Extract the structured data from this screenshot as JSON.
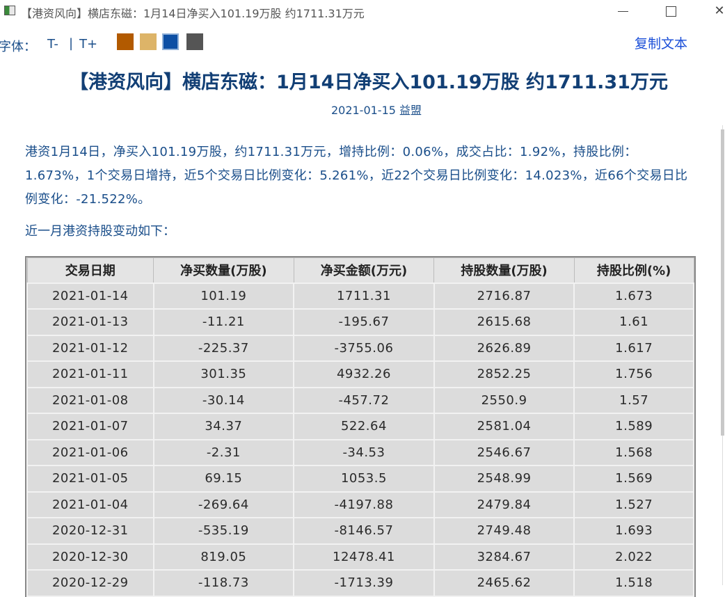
{
  "window": {
    "title": "【港资风向】横店东磁：1月14日净买入101.19万股 约1711.31万元"
  },
  "toolbar": {
    "font_label": "字体：",
    "font_decrease": "T-",
    "separator": "|",
    "font_increase": "T+",
    "theme_colors": [
      "#b25a00",
      "#ddb468",
      "#0d4fa4",
      "#555555"
    ],
    "copy_text": "复制文本"
  },
  "article": {
    "title": "【港资风向】横店东磁：1月14日净买入101.19万股 约1711.31万元",
    "meta": "2021-01-15 益盟",
    "summary": "港资1月14日，净买入101.19万股，约1711.31万元，增持比例：0.06%，成交占比：1.92%，持股比例：1.673%，1个交易日增持，近5个交易日比例变化：5.261%，近22个交易日比例变化：14.023%，近66个交易日比例变化：-21.522%。",
    "subheading": "近一月港资持股变动如下："
  },
  "table": {
    "headers": [
      "交易日期",
      "净买数量(万股)",
      "净买金额(万元)",
      "持股数量(万股)",
      "持股比例(%)"
    ],
    "rows": [
      [
        "2021-01-14",
        "101.19",
        "1711.31",
        "2716.87",
        "1.673"
      ],
      [
        "2021-01-13",
        "-11.21",
        "-195.67",
        "2615.68",
        "1.61"
      ],
      [
        "2021-01-12",
        "-225.37",
        "-3755.06",
        "2626.89",
        "1.617"
      ],
      [
        "2021-01-11",
        "301.35",
        "4932.26",
        "2852.25",
        "1.756"
      ],
      [
        "2021-01-08",
        "-30.14",
        "-457.72",
        "2550.9",
        "1.57"
      ],
      [
        "2021-01-07",
        "34.37",
        "522.64",
        "2581.04",
        "1.589"
      ],
      [
        "2021-01-06",
        "-2.31",
        "-34.53",
        "2546.67",
        "1.568"
      ],
      [
        "2021-01-05",
        "69.15",
        "1053.5",
        "2548.99",
        "1.569"
      ],
      [
        "2021-01-04",
        "-269.64",
        "-4197.88",
        "2479.84",
        "1.527"
      ],
      [
        "2020-12-31",
        "-535.19",
        "-8146.57",
        "2749.48",
        "1.693"
      ],
      [
        "2020-12-30",
        "819.05",
        "12478.41",
        "3284.67",
        "2.022"
      ],
      [
        "2020-12-29",
        "-118.73",
        "-1713.39",
        "2465.62",
        "1.518"
      ]
    ]
  }
}
